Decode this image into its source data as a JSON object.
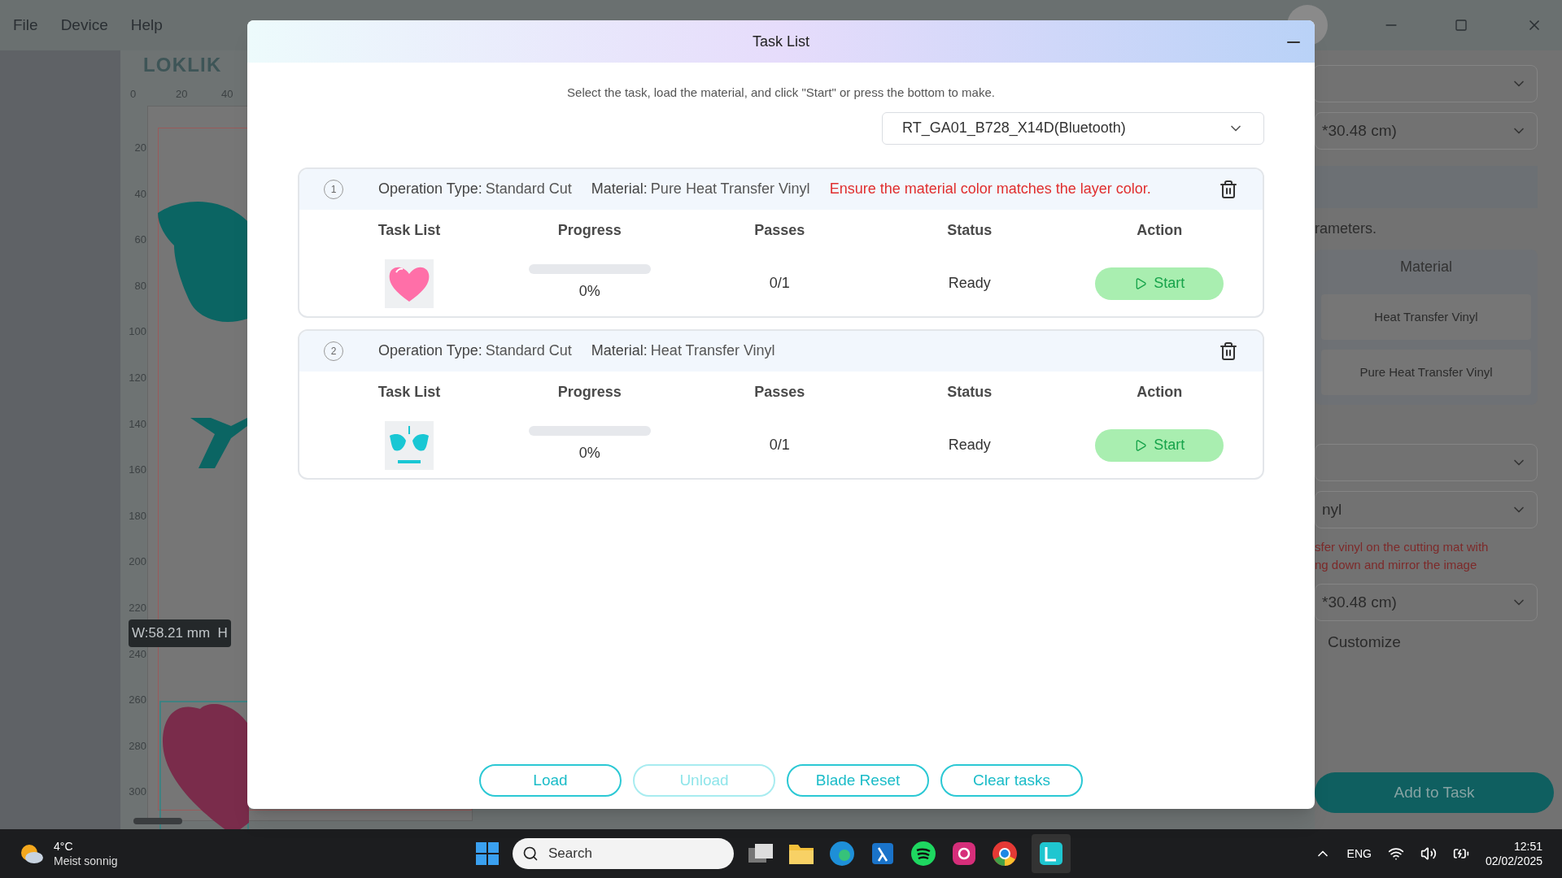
{
  "menu": [
    "File",
    "Device",
    "Help"
  ],
  "canvas": {
    "logo": "LOKLIK",
    "top_ruler": [
      "0",
      "20",
      "40"
    ],
    "left_ruler": [
      "20",
      "40",
      "60",
      "80",
      "100",
      "120",
      "140",
      "160",
      "180",
      "200",
      "220",
      "240",
      "260",
      "280",
      "300"
    ],
    "tooltip": "W:58.21 mm  H"
  },
  "side_panel": {
    "size_1": "*30.48 cm)",
    "hint": "rameters.",
    "material_header": "Material",
    "materials": [
      "Heat Transfer Vinyl",
      "Pure Heat Transfer Vinyl"
    ],
    "material_select": "nyl",
    "warning_lines": [
      "sfer vinyl on the cutting mat with",
      "ng down and mirror the image"
    ],
    "size_2": "*30.48 cm)",
    "customize": "Customize",
    "add_button": "Add to Task"
  },
  "dialog": {
    "title": "Task List",
    "instruction": "Select the task, load the material, and click \"Start\" or press the bottom to make.",
    "device": "RT_GA01_B728_X14D(Bluetooth)",
    "tasks": [
      {
        "index": "1",
        "op_label": "Operation Type:",
        "op_value": "Standard Cut",
        "mat_label": "Material:",
        "mat_value": "Pure Heat Transfer Vinyl",
        "warning": "Ensure the material color matches the layer color.",
        "columns": [
          "Task List",
          "Progress",
          "Passes",
          "Status",
          "Action"
        ],
        "kind": "heart",
        "level": 0,
        "progress": "0%",
        "passes": "0/1",
        "status": "Ready",
        "action": "Start"
      },
      {
        "index": "2",
        "op_label": "Operation Type:",
        "op_value": "Standard Cut",
        "mat_label": "Material:",
        "mat_value": "Heat Transfer Vinyl",
        "columns": [
          "Task List",
          "Progress",
          "Passes",
          "Status",
          "Action"
        ],
        "kind": "wings",
        "level": 0,
        "progress": "0%",
        "passes": "0/1",
        "status": "Ready",
        "action": "Start"
      }
    ],
    "buttons": [
      {
        "label": "Load",
        "disabled": false
      },
      {
        "label": "Unload",
        "disabled": true
      },
      {
        "label": "Blade Reset",
        "disabled": false
      },
      {
        "label": "Clear tasks",
        "disabled": false
      }
    ]
  },
  "taskbar": {
    "temperature": "4°C",
    "weather": "Meist sonnig",
    "search": "Search",
    "language": "ENG",
    "time": "12:51",
    "date": "02/02/2025"
  }
}
